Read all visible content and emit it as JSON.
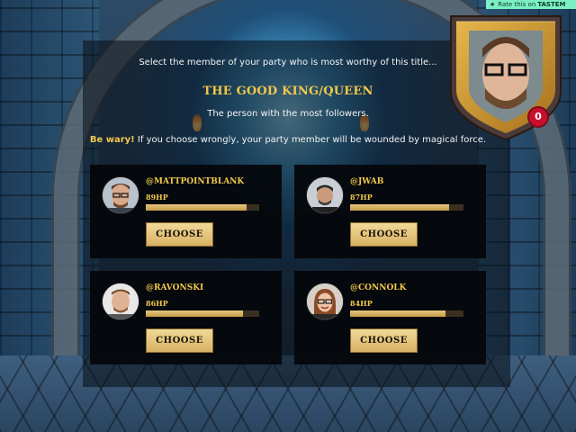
{
  "rate_banner": {
    "label": "Rate this on",
    "brand": "TASTEM",
    "star_icon": "star-icon"
  },
  "challenge": {
    "prompt": "Select the member of your party who is most worthy of this title...",
    "title": "THE GOOD KING/QUEEN",
    "description": "The person with the most followers.",
    "warning_lead": "Be wary!",
    "warning_text": " If you choose wrongly, your party member will be wounded by magical force."
  },
  "players": [
    {
      "handle": "@MATTPOINTBLANK",
      "hp_label": "89HP",
      "hp_fraction": 0.89,
      "button": "CHOOSE"
    },
    {
      "handle": "@JWAB",
      "hp_label": "87HP",
      "hp_fraction": 0.87,
      "button": "CHOOSE"
    },
    {
      "handle": "@RAVONSKI",
      "hp_label": "86HP",
      "hp_fraction": 0.86,
      "button": "CHOOSE"
    },
    {
      "handle": "@CONNOLK",
      "hp_label": "84HP",
      "hp_fraction": 0.84,
      "button": "CHOOSE"
    }
  ],
  "self": {
    "badge_count": "0"
  },
  "colors": {
    "gold_text": "#f2c84b",
    "button_gold": "#e2c27a",
    "badge_red": "#c8102e",
    "banner_green": "#7cf0c4"
  }
}
